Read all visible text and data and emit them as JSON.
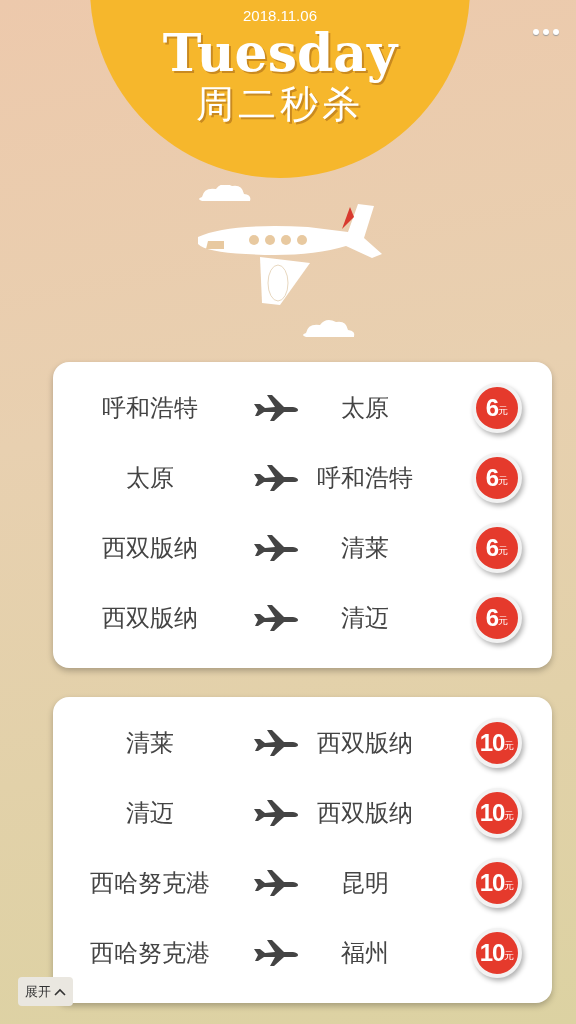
{
  "banner": {
    "date": "2018.11.06",
    "title": "Tuesday",
    "subtitle": "周二秒杀"
  },
  "cards": [
    {
      "routes": [
        {
          "from": "呼和浩特",
          "to": "太原",
          "price": "6",
          "unit": "元"
        },
        {
          "from": "太原",
          "to": "呼和浩特",
          "price": "6",
          "unit": "元"
        },
        {
          "from": "西双版纳",
          "to": "清莱",
          "price": "6",
          "unit": "元"
        },
        {
          "from": "西双版纳",
          "to": "清迈",
          "price": "6",
          "unit": "元"
        }
      ]
    },
    {
      "routes": [
        {
          "from": "清莱",
          "to": "西双版纳",
          "price": "10",
          "unit": "元"
        },
        {
          "from": "清迈",
          "to": "西双版纳",
          "price": "10",
          "unit": "元"
        },
        {
          "from": "西哈努克港",
          "to": "昆明",
          "price": "10",
          "unit": "元"
        },
        {
          "from": "西哈努克港",
          "to": "福州",
          "price": "10",
          "unit": "元"
        }
      ]
    }
  ],
  "expand_button": {
    "label": "展开"
  }
}
